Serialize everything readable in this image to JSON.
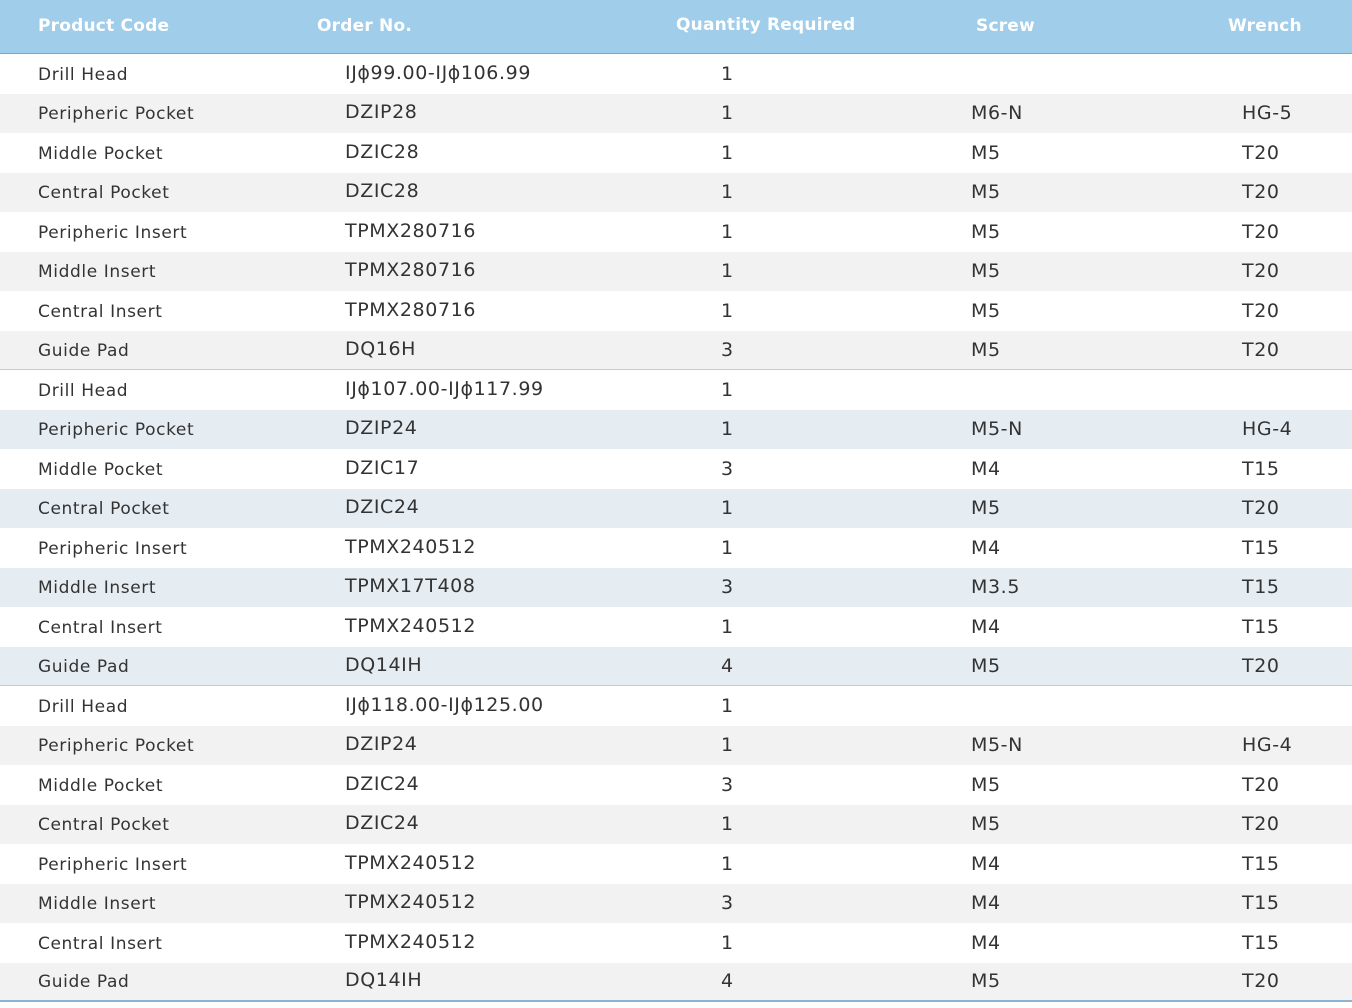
{
  "columns": {
    "product_code": "Product Code",
    "order_no": "Order No.",
    "quantity": "Quantity Required",
    "screw": "Screw",
    "wrench": "Wrench"
  },
  "rows": [
    {
      "product": "Drill Head",
      "order": "IJϕ99.00-IJϕ106.99",
      "qty": "1",
      "screw": "",
      "wrench": ""
    },
    {
      "product": "Peripheric Pocket",
      "order": "DZIP28",
      "qty": "1",
      "screw": "M6-N",
      "wrench": "HG-5"
    },
    {
      "product": "Middle Pocket",
      "order": "DZIC28",
      "qty": "1",
      "screw": "M5",
      "wrench": "T20"
    },
    {
      "product": "Central Pocket",
      "order": "DZIC28",
      "qty": "1",
      "screw": "M5",
      "wrench": "T20"
    },
    {
      "product": "Peripheric Insert",
      "order": "TPMX280716",
      "qty": "1",
      "screw": "M5",
      "wrench": "T20"
    },
    {
      "product": "Middle Insert",
      "order": "TPMX280716",
      "qty": "1",
      "screw": "M5",
      "wrench": "T20"
    },
    {
      "product": "Central Insert",
      "order": "TPMX280716",
      "qty": "1",
      "screw": "M5",
      "wrench": "T20"
    },
    {
      "product": "Guide Pad",
      "order": "DQ16H",
      "qty": "3",
      "screw": "M5",
      "wrench": "T20"
    },
    {
      "product": "Drill Head",
      "order": "IJϕ107.00-IJϕ117.99",
      "qty": "1",
      "screw": "",
      "wrench": ""
    },
    {
      "product": "Peripheric Pocket",
      "order": "DZIP24",
      "qty": "1",
      "screw": "M5-N",
      "wrench": "HG-4"
    },
    {
      "product": "Middle Pocket",
      "order": "DZIC17",
      "qty": "3",
      "screw": "M4",
      "wrench": "T15"
    },
    {
      "product": "Central Pocket",
      "order": "DZIC24",
      "qty": "1",
      "screw": "M5",
      "wrench": "T20"
    },
    {
      "product": "Peripheric Insert",
      "order": "TPMX240512",
      "qty": "1",
      "screw": "M4",
      "wrench": "T15"
    },
    {
      "product": "Middle Insert",
      "order": "TPMX17T408",
      "qty": "3",
      "screw": "M3.5",
      "wrench": "T15"
    },
    {
      "product": "Central Insert",
      "order": "TPMX240512",
      "qty": "1",
      "screw": "M4",
      "wrench": "T15"
    },
    {
      "product": "Guide Pad",
      "order": "DQ14IH",
      "qty": "4",
      "screw": "M5",
      "wrench": "T20"
    },
    {
      "product": "Drill Head",
      "order": "IJϕ118.00-IJϕ125.00",
      "qty": "1",
      "screw": "",
      "wrench": ""
    },
    {
      "product": "Peripheric Pocket",
      "order": "DZIP24",
      "qty": "1",
      "screw": "M5-N",
      "wrench": "HG-4"
    },
    {
      "product": "Middle Pocket",
      "order": "DZIC24",
      "qty": "3",
      "screw": "M5",
      "wrench": "T20"
    },
    {
      "product": "Central Pocket",
      "order": "DZIC24",
      "qty": "1",
      "screw": "M5",
      "wrench": "T20"
    },
    {
      "product": "Peripheric Insert",
      "order": "TPMX240512",
      "qty": "1",
      "screw": "M4",
      "wrench": "T15"
    },
    {
      "product": "Middle Insert",
      "order": "TPMX240512",
      "qty": "3",
      "screw": "M4",
      "wrench": "T15"
    },
    {
      "product": "Central Insert",
      "order": "TPMX240512",
      "qty": "1",
      "screw": "M4",
      "wrench": "T15"
    },
    {
      "product": "Guide Pad",
      "order": "DQ14IH",
      "qty": "4",
      "screw": "M5",
      "wrench": "T20"
    }
  ],
  "colors": {
    "header_bg": "#a0cde9",
    "header_text": "#ffffff",
    "stripe_grey": "#f2f2f2",
    "stripe_blue": "#e5ecf2",
    "text": "#333333"
  }
}
